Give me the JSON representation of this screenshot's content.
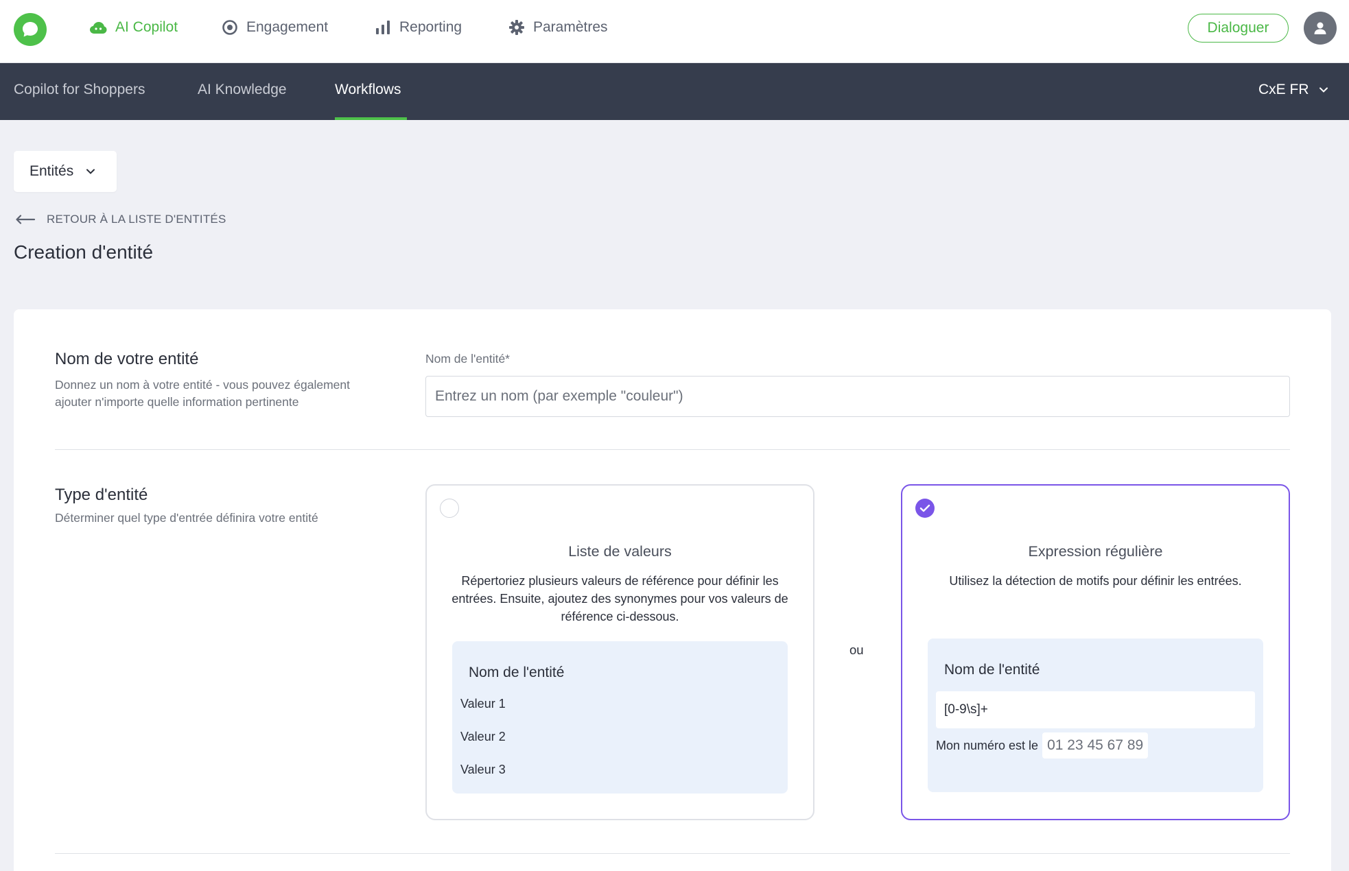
{
  "topnav": {
    "items": [
      {
        "label": "AI Copilot",
        "icon": "cloud-icon",
        "active": true
      },
      {
        "label": "Engagement",
        "icon": "target-icon",
        "active": false
      },
      {
        "label": "Reporting",
        "icon": "bar-chart-icon",
        "active": false
      },
      {
        "label": "Paramètres",
        "icon": "gear-icon",
        "active": false
      }
    ],
    "dialog_button": "Dialoguer",
    "accent": "#4ab846"
  },
  "subnav": {
    "items": [
      {
        "label": "Copilot for Shoppers",
        "active": false
      },
      {
        "label": "AI Knowledge",
        "active": false
      },
      {
        "label": "Workflows",
        "active": true
      }
    ],
    "org_selector": "CxE FR"
  },
  "entity_dropdown": {
    "label": "Entités"
  },
  "back_link": "RETOUR À LA LISTE D'ENTITÉS",
  "page_title": "Creation d'entité",
  "name_section": {
    "title": "Nom de votre entité",
    "description_line1": "Donnez un nom à votre entité - vous pouvez également",
    "description_line2": "ajouter n'importe quelle information pertinente",
    "field_label": "Nom de l'entité*",
    "placeholder": "Entrez un nom (par exemple \"couleur\")",
    "value": ""
  },
  "type_section": {
    "title": "Type d'entité",
    "description": "Déterminer quel type d'entrée définira votre entité",
    "separator": "ou",
    "selected_color": "#7a55e8",
    "options": [
      {
        "title": "Liste de valeurs",
        "description": "Répertoriez plusieurs valeurs de référence pour définir les entrées. Ensuite, ajoutez des synonymes pour vos valeurs de référence ci-dessous.",
        "selected": false,
        "preview_title": "Nom de l'entité",
        "values": [
          "Valeur 1",
          "Valeur 2",
          "Valeur 3"
        ]
      },
      {
        "title": "Expression régulière",
        "description": "Utilisez la détection de motifs pour définir les entrées.",
        "selected": true,
        "preview_title": "Nom de l'entité",
        "pattern": "[0-9\\s]+",
        "sample_prefix": "Mon numéro est le",
        "sample_match": "01 23 45 67 89"
      }
    ]
  }
}
